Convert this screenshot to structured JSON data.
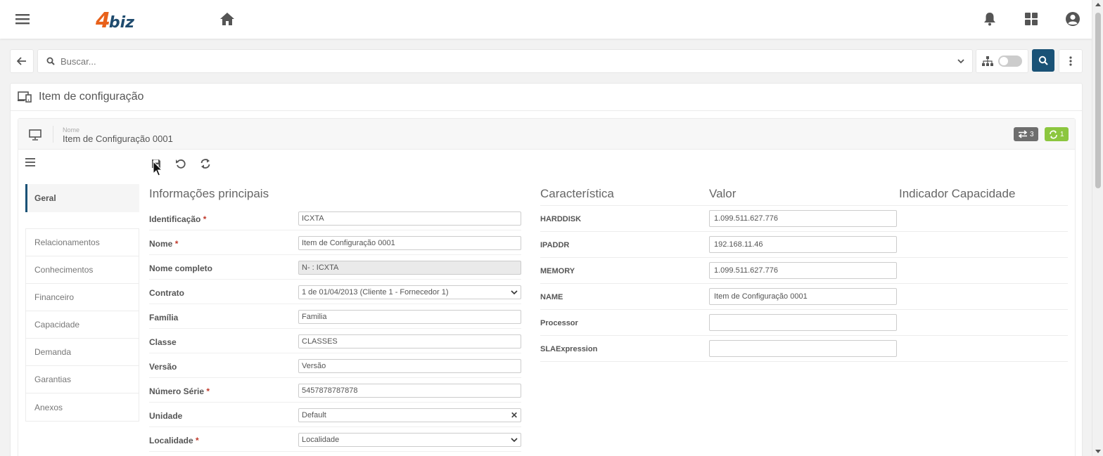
{
  "header": {
    "logo": {
      "prefix": "4",
      "name": "biz"
    },
    "icons": [
      "hamburger-icon",
      "home-icon",
      "bell-icon",
      "apps-grid-icon",
      "user-account-icon"
    ]
  },
  "search": {
    "placeholder": "Buscar..."
  },
  "page": {
    "title": "Item de configuração",
    "name_label": "Nome",
    "name_value": "Item de Configuração 0001",
    "badges": {
      "relations_count": "3",
      "sync_count": "1"
    }
  },
  "nav": {
    "active": "Geral",
    "items": [
      "Relacionamentos",
      "Conhecimentos",
      "Financeiro",
      "Capacidade",
      "Demanda",
      "Garantias",
      "Anexos"
    ]
  },
  "form": {
    "title": "Informações principais",
    "fields": [
      {
        "label": "Identificação",
        "required": "*",
        "value": "ICXTA"
      },
      {
        "label": "Nome",
        "required": "*",
        "value": "Item de Configuração 0001"
      },
      {
        "label": "Nome completo",
        "required": "",
        "value": "N- : ICXTA"
      },
      {
        "label": "Contrato",
        "required": "",
        "value": "1 de 01/04/2013 (Cliente 1 - Fornecedor 1)"
      },
      {
        "label": "Família",
        "required": "",
        "value": "Familia"
      },
      {
        "label": "Classe",
        "required": "",
        "value": "CLASSES"
      },
      {
        "label": "Versão",
        "required": "",
        "value": "Versão"
      },
      {
        "label": "Número Série",
        "required": "*",
        "value": "5457878787878"
      },
      {
        "label": "Unidade",
        "required": "",
        "value": "Default"
      },
      {
        "label": "Localidade",
        "required": "*",
        "value": "Localidade"
      }
    ]
  },
  "characteristics": {
    "headers": [
      "Característica",
      "Valor",
      "Indicador Capacidade"
    ],
    "rows": [
      {
        "name": "HARDDISK",
        "value": "1.099.511.627.776"
      },
      {
        "name": "IPADDR",
        "value": "192.168.11.46"
      },
      {
        "name": "MEMORY",
        "value": "1.099.511.627.776"
      },
      {
        "name": "NAME",
        "value": "Item de Configuração 0001"
      },
      {
        "name": "Processor",
        "value": ""
      },
      {
        "name": "SLAExpression",
        "value": ""
      }
    ]
  }
}
